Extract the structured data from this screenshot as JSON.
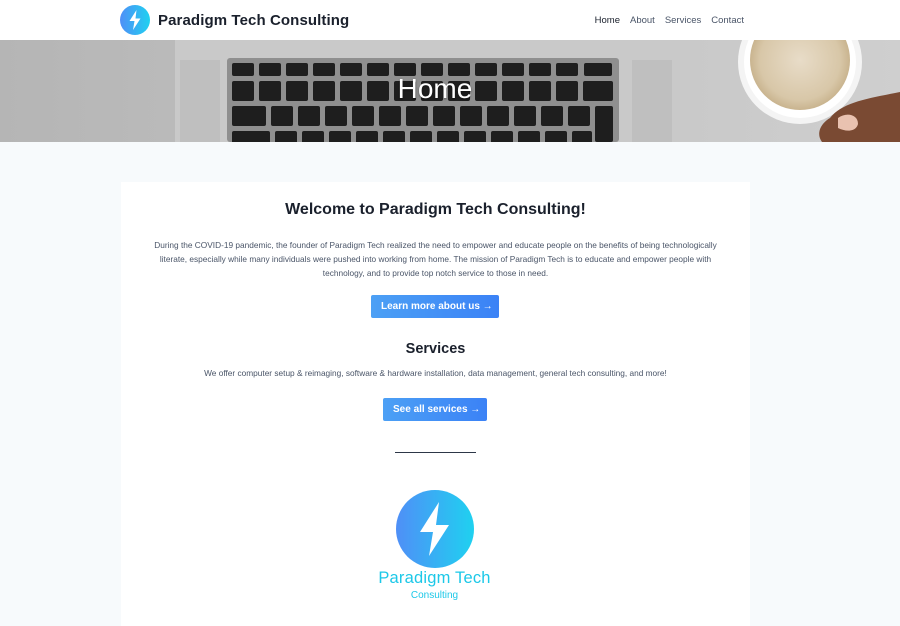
{
  "header": {
    "brand_name": "Paradigm Tech Consulting",
    "nav": [
      {
        "label": "Home",
        "active": true
      },
      {
        "label": "About",
        "active": false
      },
      {
        "label": "Services",
        "active": false
      },
      {
        "label": "Contact",
        "active": false
      }
    ]
  },
  "hero": {
    "title": "Home"
  },
  "main": {
    "welcome_title": "Welcome to Paradigm Tech Consulting!",
    "intro_text": "During the COVID-19 pandemic, the founder of Paradigm Tech realized the need to empower and educate people on the benefits of being technologically literate, especially while many individuals were pushed into working from home. The mission of Paradigm Tech is to educate and empower people with technology, and to provide top notch service to those in need.",
    "about_button": "Learn more about us →",
    "services_title": "Services",
    "services_text": "We offer computer setup & reimaging, software & hardware installation, data management, general tech consulting, and more!",
    "services_button": "See all services →",
    "logo_word": "Paradigm Tech",
    "logo_sub": "Consulting"
  },
  "colors": {
    "accent": "#3b82f6",
    "logo_cyan": "#1cc8e8",
    "background": "#f7fafc"
  },
  "icons": {
    "brand_logo": "lightning-bolt-icon"
  }
}
